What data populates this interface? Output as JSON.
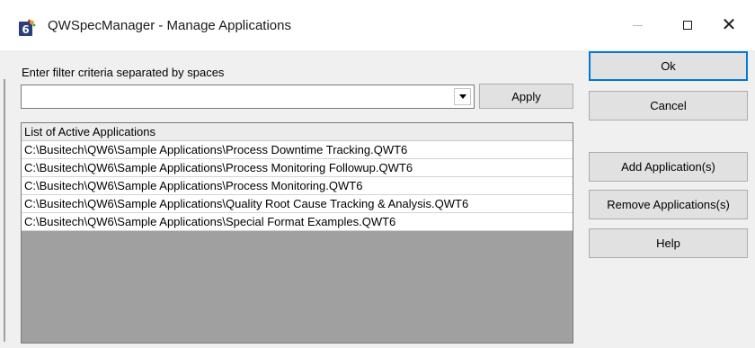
{
  "window": {
    "title": "QWSpecManager - Manage Applications",
    "icon": "app-icon",
    "accent_color": "#0078d7"
  },
  "filter": {
    "label": "Enter filter criteria separated by spaces",
    "value": "",
    "apply_label": "Apply"
  },
  "list": {
    "header": "List of Active Applications",
    "items": [
      "C:\\Busitech\\QW6\\Sample Applications\\Process Downtime Tracking.QWT6",
      "C:\\Busitech\\QW6\\Sample Applications\\Process Monitoring Followup.QWT6",
      "C:\\Busitech\\QW6\\Sample Applications\\Process Monitoring.QWT6",
      "C:\\Busitech\\QW6\\Sample Applications\\Quality Root Cause Tracking & Analysis.QWT6",
      "C:\\Busitech\\QW6\\Sample Applications\\Special Format Examples.QWT6"
    ]
  },
  "buttons": {
    "ok": "Ok",
    "cancel": "Cancel",
    "add": "Add Application(s)",
    "remove": "Remove Applications(s)",
    "help": "Help"
  }
}
